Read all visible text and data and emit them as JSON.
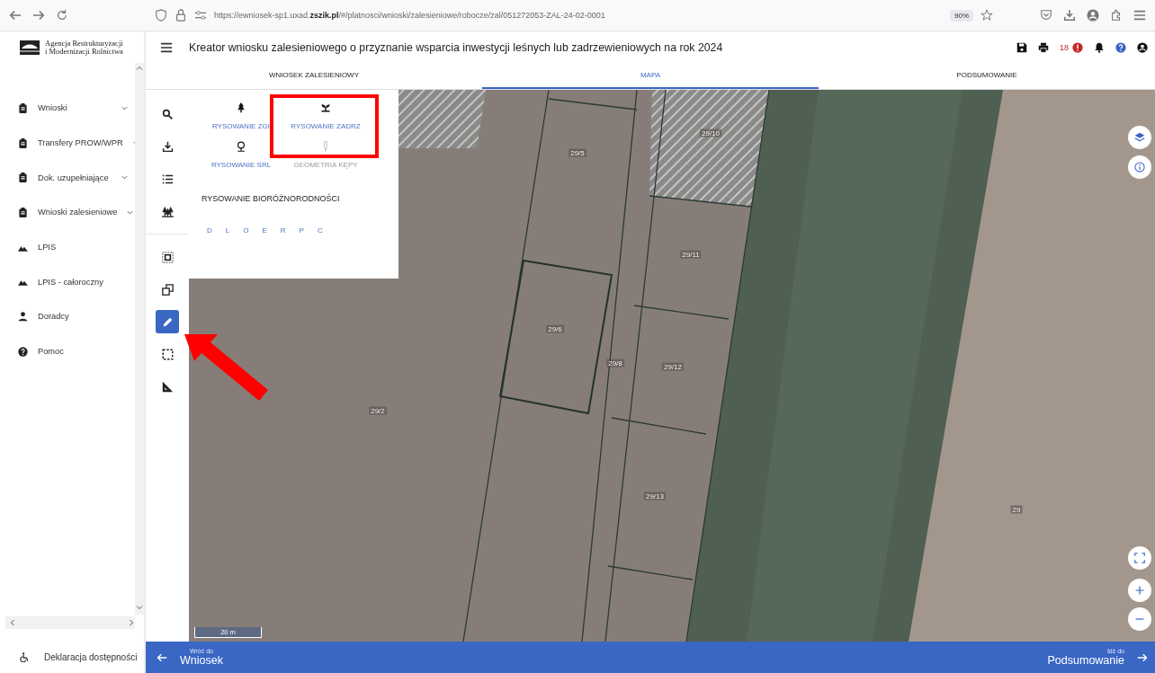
{
  "browser": {
    "url": "https://ewniosek-sp1.uxad.**zszik.pl**/#/platnosci/wnioski/zalesieniowe/robocze/zal/051272053-ZAL-24-02-0001",
    "zoom": "90%"
  },
  "logo": {
    "lines": [
      "Agencja Restrukturyzacji",
      "i Modernizacji Rolnictwa"
    ]
  },
  "header": {
    "title": "Kreator wniosku zalesieniowego o przyznanie wsparcia inwestycji leśnych lub zadrzewieniowych na rok 2024",
    "alert_count": "18"
  },
  "tabs": [
    {
      "label": "WNIOSEK ZALESIENIOWY",
      "selected": false
    },
    {
      "label": "MAPA",
      "selected": true
    },
    {
      "label": "PODSUMOWANIE",
      "selected": false
    }
  ],
  "sidebar": {
    "items": [
      {
        "label": "Wnioski",
        "kind": "document",
        "chevron": true
      },
      {
        "label": "Transfery PROW/WPR",
        "kind": "document",
        "chevron": true
      },
      {
        "label": "Dok. uzupełniające",
        "kind": "document",
        "chevron": true
      },
      {
        "label": "Wnioski zalesieniowe",
        "kind": "document",
        "chevron": true
      },
      {
        "label": "LPIS",
        "kind": "terrain",
        "chevron": false
      },
      {
        "label": "LPIS - całoroczny",
        "kind": "terrain",
        "chevron": false
      },
      {
        "label": "Doradcy",
        "kind": "person",
        "chevron": false
      },
      {
        "label": "Pomoc",
        "kind": "help",
        "chevron": false
      }
    ],
    "footer_link": "Deklaracja dostępności"
  },
  "map_tools": [
    [
      {
        "kind": "search",
        "selected": false
      },
      {
        "kind": "download",
        "selected": false
      },
      {
        "kind": "list",
        "selected": false
      },
      {
        "kind": "trees",
        "selected": false
      }
    ],
    [
      {
        "kind": "select-area",
        "selected": false
      },
      {
        "kind": "copy",
        "selected": false
      },
      {
        "kind": "pencil",
        "selected": true,
        "pointed": true
      },
      {
        "kind": "dashed-rect",
        "selected": false
      },
      {
        "kind": "ruler",
        "selected": false
      }
    ]
  ],
  "draw_panel": {
    "items": [
      {
        "label": "RYSOWANIE ZGI",
        "kind": "forest",
        "disabled": false,
        "highlighted": false
      },
      {
        "label": "RYSOWANIE ZADRZ",
        "kind": "planting",
        "disabled": false,
        "highlighted": true
      },
      {
        "label": "RYSOWANIE SRL",
        "kind": "tree",
        "disabled": false,
        "highlighted": false
      },
      {
        "label": "GEOMETRIA KĘPY",
        "kind": "clump",
        "disabled": true,
        "highlighted": false
      }
    ],
    "section_title": "RYSOWANIE BIORÓŻNORODNOŚCI",
    "letters": [
      "D",
      "L",
      "O",
      "E",
      "R",
      "P",
      "C"
    ]
  },
  "map": {
    "parcels": [
      "29/5",
      "29/10",
      "29/11",
      "29/6",
      "29/8",
      "29/12",
      "29/2",
      "29/13",
      "29"
    ],
    "scale": "20 m"
  },
  "bottom_nav": {
    "back": {
      "caption": "Wróć do",
      "label": "Wniosek"
    },
    "next": {
      "caption": "Idź do",
      "label": "Podsumowanie"
    }
  }
}
